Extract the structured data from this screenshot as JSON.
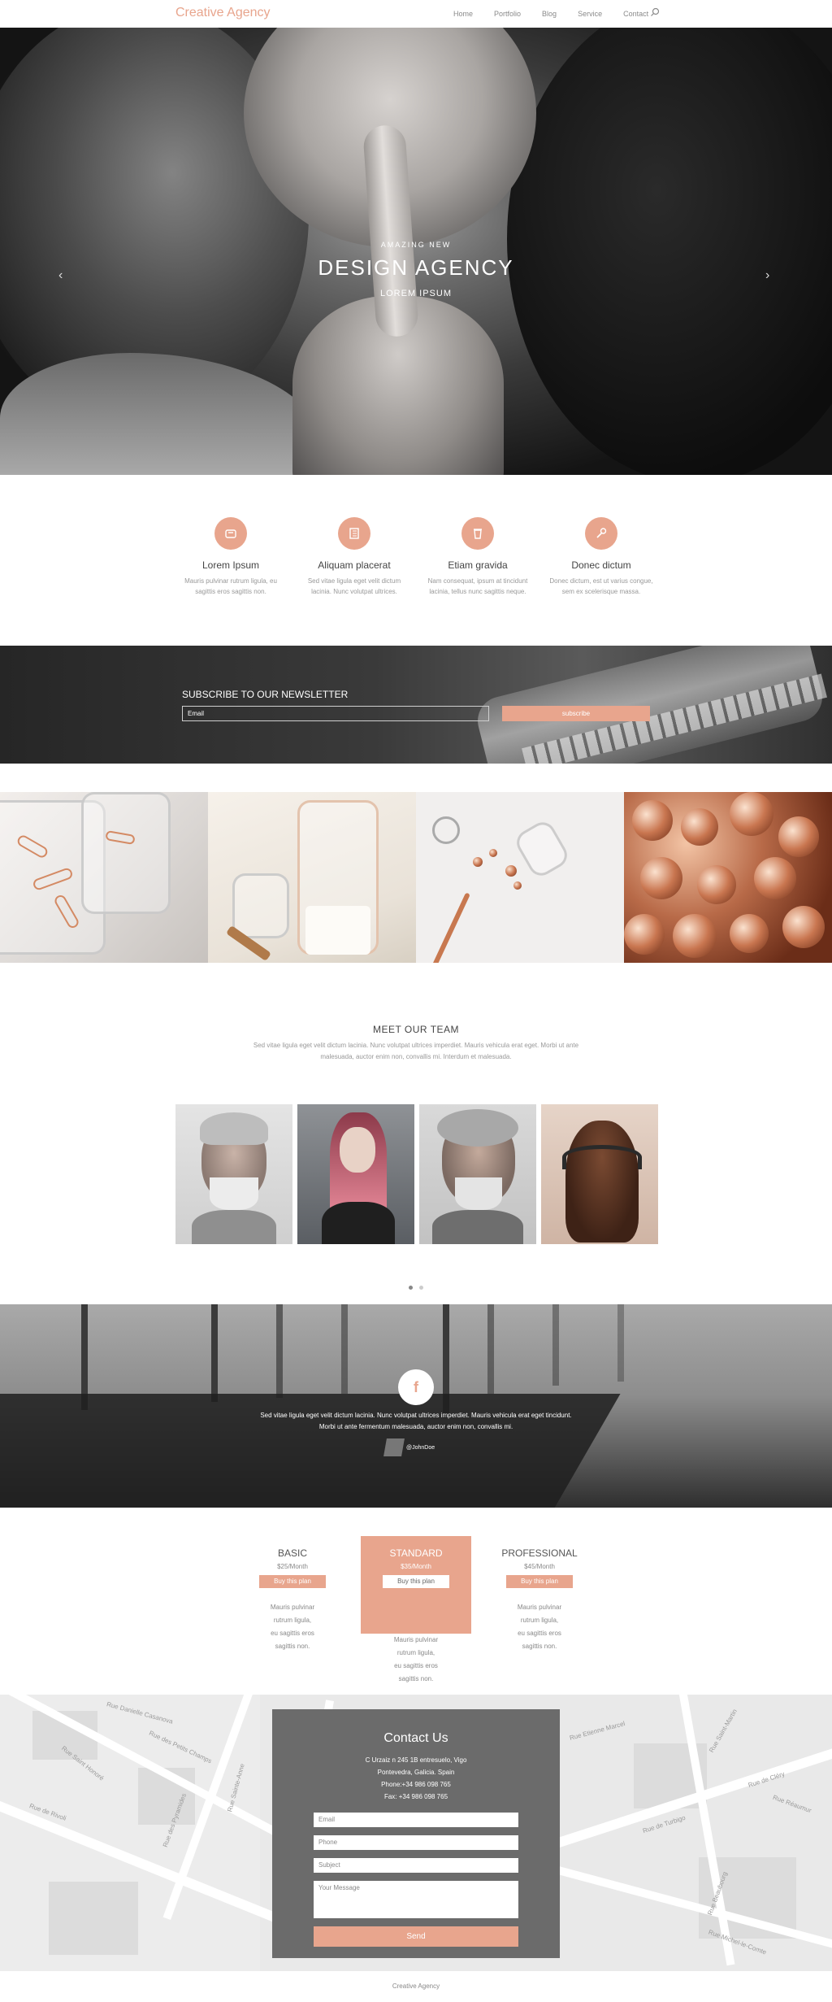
{
  "brand": "Creative Agency",
  "nav": [
    "Home",
    "Portfolio",
    "Blog",
    "Service",
    "Contact"
  ],
  "hero": {
    "eyebrow": "AMAZING NEW",
    "title": "DESIGN AGENCY",
    "subtitle": "LOREM IPSUM",
    "prev_arrow": "‹",
    "next_arrow": "›"
  },
  "features": [
    {
      "icon": "box-icon",
      "title": "Lorem Ipsum",
      "text": "Mauris pulvinar rutrum ligula, eu sagittis eros sagittis non."
    },
    {
      "icon": "book-icon",
      "title": "Aliquam placerat",
      "text": "Sed vitae ligula eget velit dictum lacinia. Nunc volutpat ultrices."
    },
    {
      "icon": "cup-icon",
      "title": "Etiam gravida",
      "text": "Nam consequat, ipsum at tincidunt lacinia, tellus nunc sagittis neque."
    },
    {
      "icon": "wrench-icon",
      "title": "Donec dictum",
      "text": "Donec dictum, est ut varius congue, sem ex scelerisque massa."
    }
  ],
  "newsletter": {
    "title": "SUBSCRIBE TO OUR NEWSLETTER",
    "placeholder": "Email",
    "button": "subscribe"
  },
  "team": {
    "title": "MEET OUR TEAM",
    "text": "Sed vitae ligula eget velit dictum lacinia. Nunc volutpat ultrices imperdiet. Mauris vehicula erat eget. Morbi ut ante malesuada, auctor enim non, convallis mi. Interdum et malesuada."
  },
  "testimonial": {
    "icon": "f",
    "quote_1": "Sed vitae ligula eget velit dictum lacinia. Nunc volutpat ultrices imperdiet. Mauris vehicula erat eget tincidunt.",
    "quote_2": "Morbi ut ante fermentum malesuada, auctor enim non, convallis mi.",
    "author": "@JohnDoe"
  },
  "pricing": [
    {
      "name": "BASIC",
      "price": "$25/Month",
      "button": "Buy this plan",
      "desc": [
        "Mauris pulvinar",
        "rutrum ligula,",
        "eu sagittis eros",
        "sagittis non."
      ]
    },
    {
      "name": "STANDARD",
      "price": "$35/Month",
      "button": "Buy this plan",
      "desc": [
        "Mauris pulvinar",
        "rutrum ligula,",
        "eu sagittis eros",
        "sagittis non."
      ]
    },
    {
      "name": "PROFESSIONAL",
      "price": "$45/Month",
      "button": "Buy this plan",
      "desc": [
        "Mauris pulvinar",
        "rutrum ligula,",
        "eu sagittis eros",
        "sagittis non."
      ]
    }
  ],
  "map_labels": [
    "Rue Danielle Casanova",
    "Rue des Petits Champs",
    "Rue Saint Honoré",
    "Rue des Pyramides",
    "Rue de Rivoli",
    "Rue Sainte-Anne",
    "Rue de Turbigo",
    "Rue Saint-Martin",
    "Rue Beaubourg",
    "Rue Michel-le-Comte",
    "Rue Réaumur",
    "Rue Etienne Marcel",
    "Rue de Cléry"
  ],
  "contact": {
    "title": "Contact Us",
    "address_1": "C Urzaiz n 245 1B entresuelo, Vigo",
    "address_2": "Pontevedra, Galicia. Spain",
    "phone": "Phone:+34 986 098 765",
    "fax": "Fax: +34 986 098 765",
    "email_placeholder": "Email",
    "phone_placeholder": "Phone",
    "subject_placeholder": "Subject",
    "message_placeholder": "Your Message",
    "send": "Send"
  },
  "footer": "Creative Agency"
}
